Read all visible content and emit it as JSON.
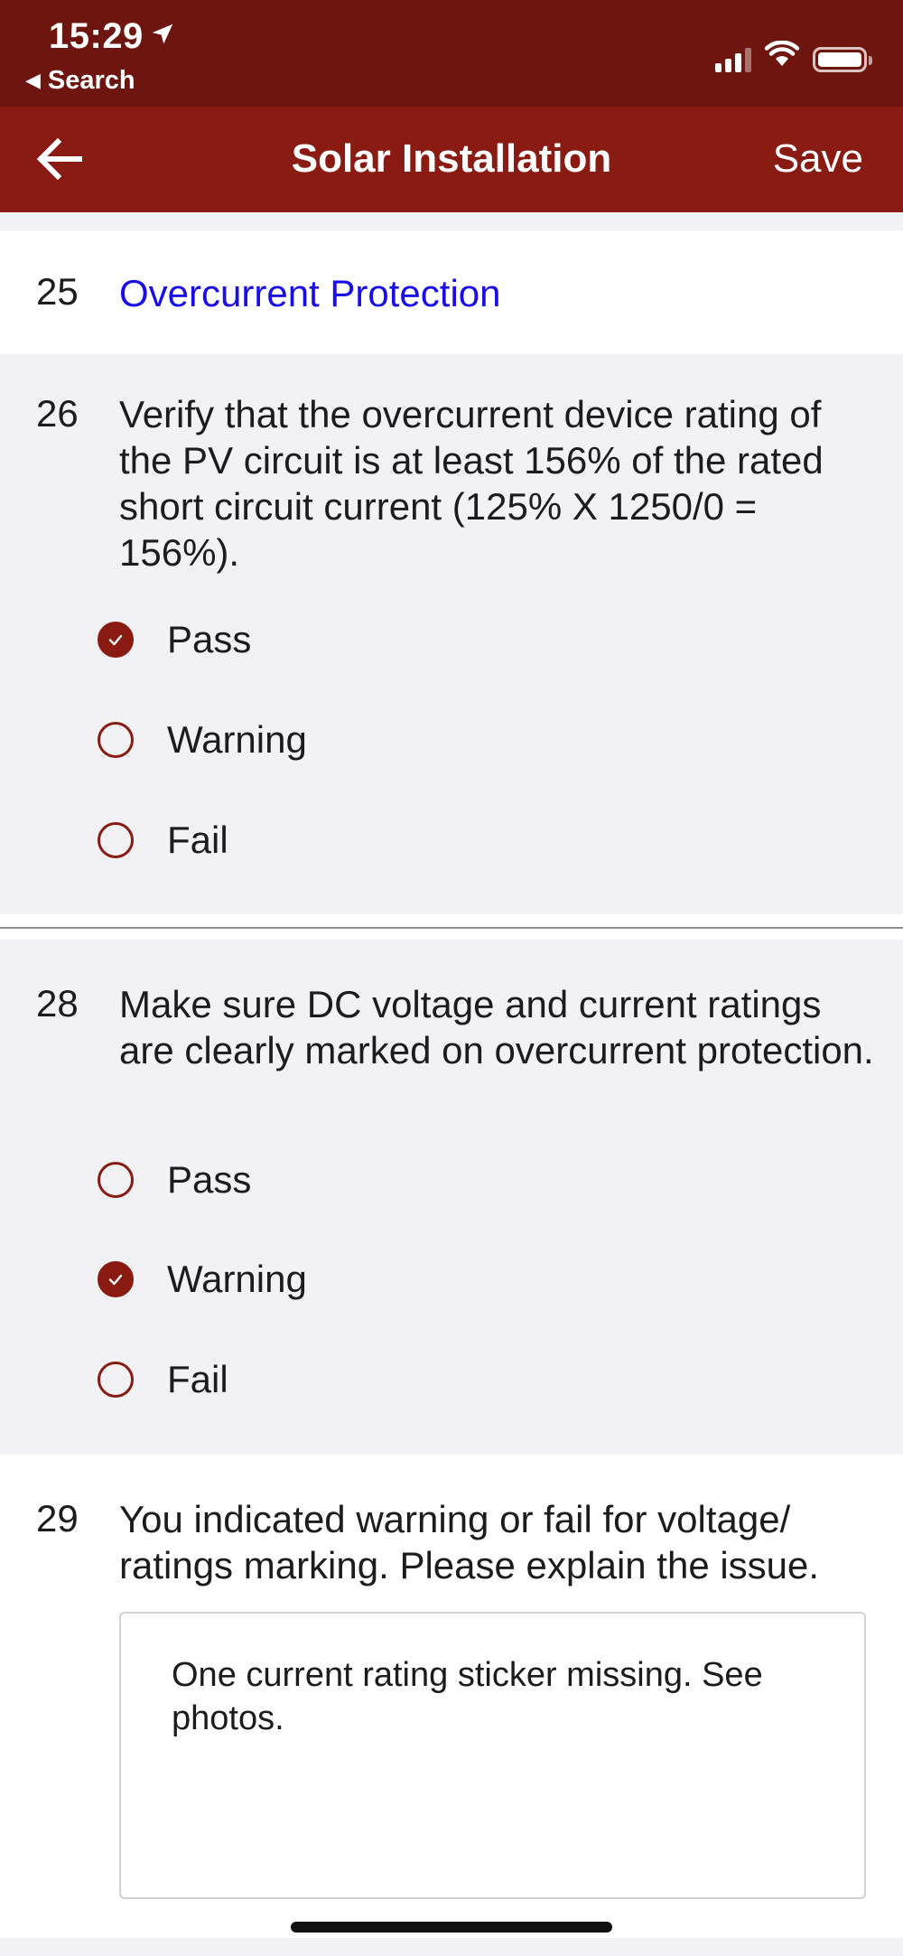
{
  "status_bar": {
    "time": "15:29",
    "back_app": "Search"
  },
  "nav": {
    "title": "Solar Installation",
    "save_label": "Save"
  },
  "q25": {
    "number": "25",
    "title": "Overcurrent Protection"
  },
  "q26": {
    "number": "26",
    "text": "Verify that the overcurrent device rating of the PV circuit is at least 156% of the rated short circuit current (125% X 1250/0 = 156%).",
    "options": [
      "Pass",
      "Warning",
      "Fail"
    ],
    "selected": "Pass"
  },
  "q28": {
    "number": "28",
    "text": "Make sure DC voltage and current ratings are clearly marked on overcurrent protection.",
    "options": [
      "Pass",
      "Warning",
      "Fail"
    ],
    "selected": "Warning"
  },
  "q29": {
    "number": "29",
    "text": "You indicated warning or fail for voltage/ ratings marking. Please explain the issue.",
    "answer": "One current rating sticker missing. See photos."
  },
  "colors": {
    "status_bar": "#6f150f",
    "nav_bar": "#8a1b12",
    "link": "#1a0ee8",
    "accent": "#8a1b12"
  },
  "icons": {
    "location": "location-arrow-icon",
    "back": "arrow-left-icon",
    "check": "checkmark-icon"
  }
}
